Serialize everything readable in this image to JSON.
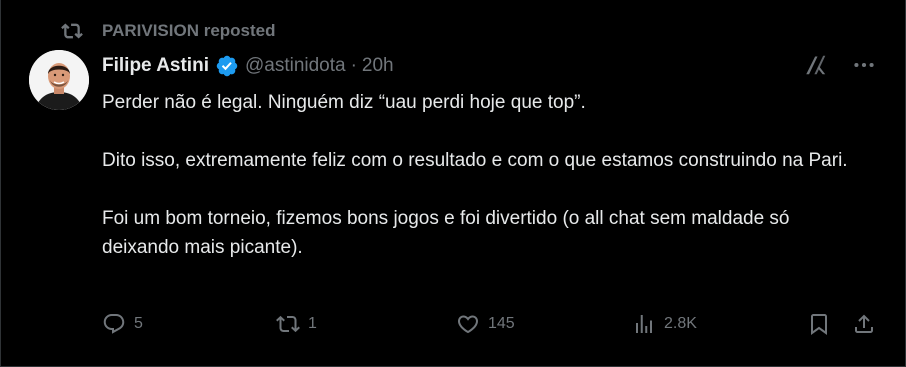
{
  "repost": {
    "label": "PARIVISION reposted",
    "icon": "repost-icon"
  },
  "author": {
    "name": "Filipe Astini",
    "handle": "@astinidota",
    "separator": "·",
    "time": "20h",
    "verified": true,
    "avatar": "avatar-photo"
  },
  "tweet": {
    "paragraphs": [
      "Perder não é legal. Ninguém diz “uau perdi hoje que top”.",
      "Dito isso, extremamente feliz com o resultado e com o que estamos construindo na Pari.",
      "Foi um bom torneio, fizemos bons jogos e foi divertido (o all chat sem maldade só deixando mais picante)."
    ]
  },
  "actions": {
    "replies": "5",
    "reposts": "1",
    "likes": "145",
    "views": "2.8K"
  },
  "colors": {
    "background": "#000000",
    "text": "#e7e9ea",
    "muted": "#71767b",
    "verified": "#1d9bf0",
    "border": "#2f3336"
  }
}
